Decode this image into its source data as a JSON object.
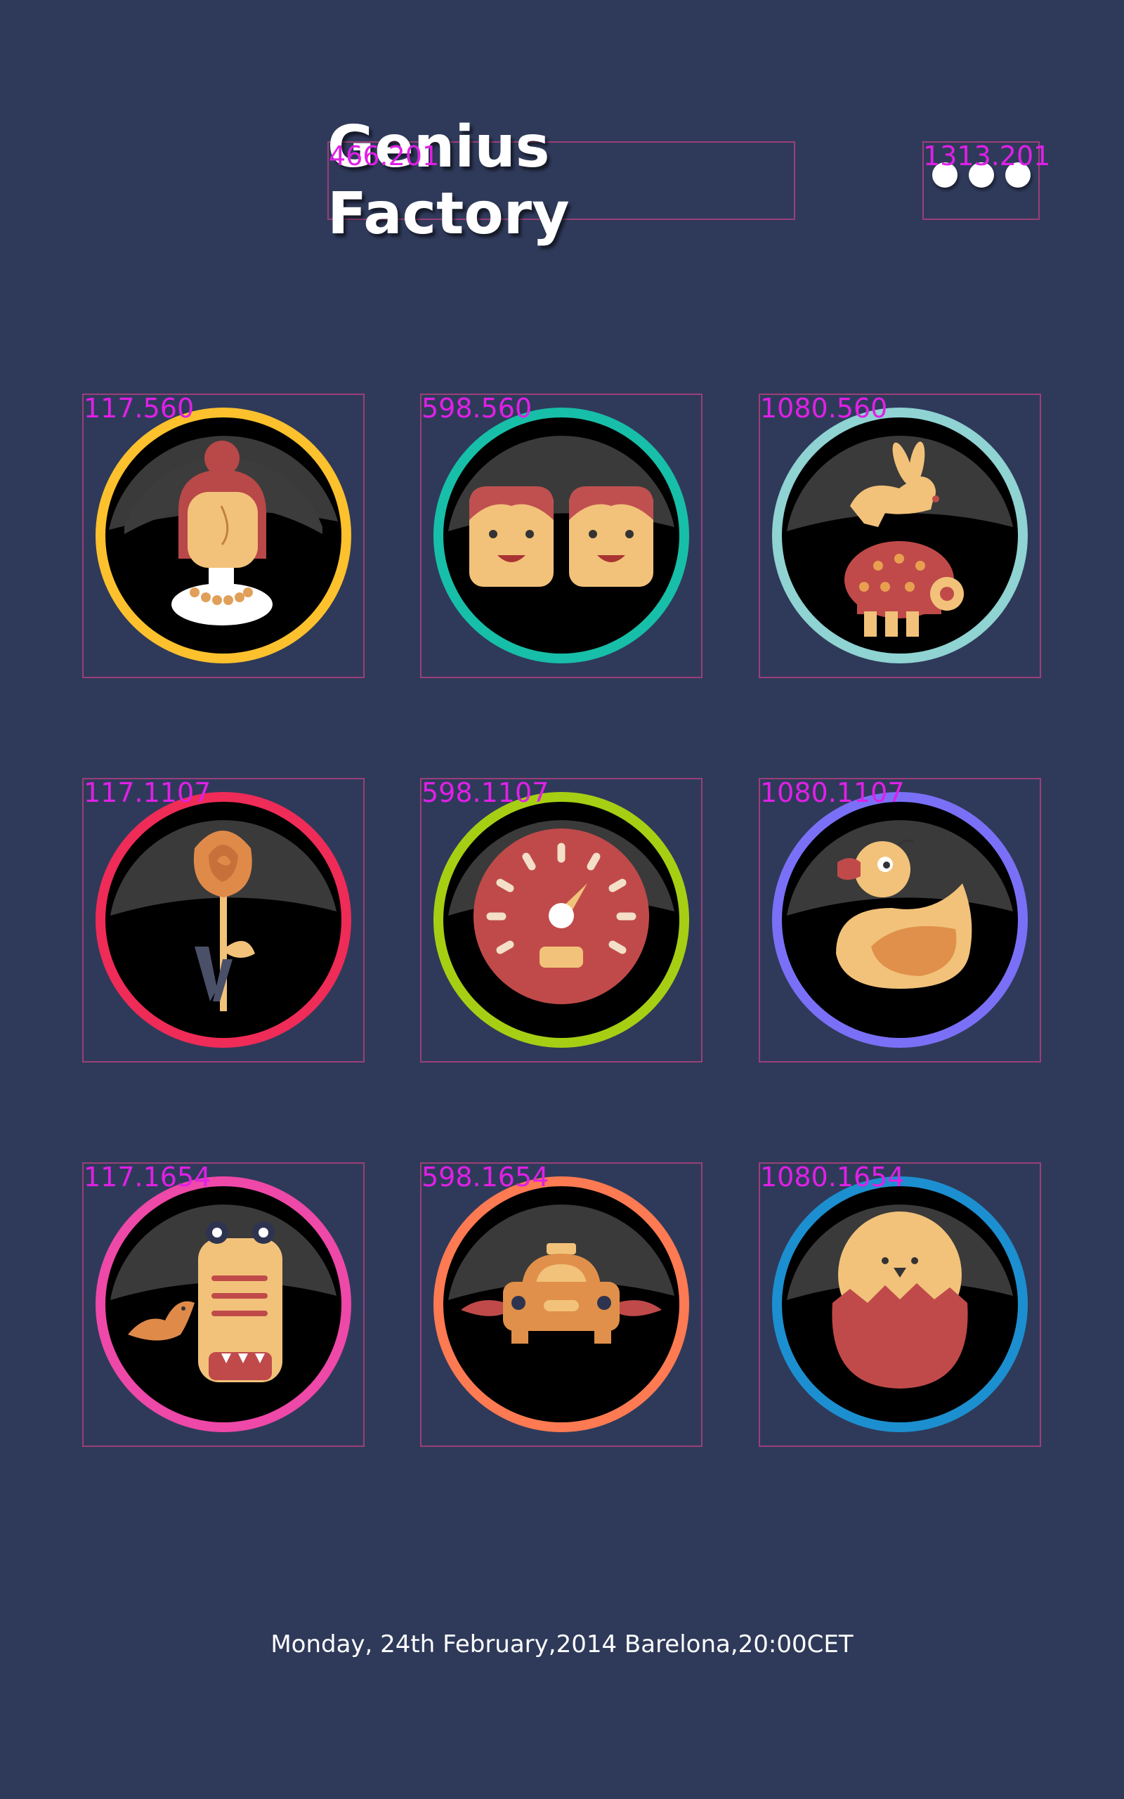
{
  "header": {
    "title": "Genius Factory",
    "title_coord": "466.201",
    "menu_coord": "1313.201",
    "menu_icon": "more-dots-icon"
  },
  "grid": [
    {
      "coord": "117.560",
      "icon": "woman-icon",
      "ring": "#fcc12d"
    },
    {
      "coord": "598.560",
      "icon": "twins-icon",
      "ring": "#17bfa8"
    },
    {
      "coord": "1080.560",
      "icon": "rabbit-tortoise-icon",
      "ring": "#8fd3d3"
    },
    {
      "coord": "117.1107",
      "icon": "rose-icon",
      "ring": "#ef2b57"
    },
    {
      "coord": "598.1107",
      "icon": "speedometer-icon",
      "ring": "#a6cf14"
    },
    {
      "coord": "1080.1107",
      "icon": "duck-icon",
      "ring": "#7a70f7"
    },
    {
      "coord": "117.1654",
      "icon": "crocodile-bird-icon",
      "ring": "#ee48a8"
    },
    {
      "coord": "598.1654",
      "icon": "winged-taxi-icon",
      "ring": "#fd7a52"
    },
    {
      "coord": "1080.1654",
      "icon": "hatching-chick-icon",
      "ring": "#1c8fd0"
    }
  ],
  "colors": {
    "background": "#2f3a5a",
    "guide": "#9a3f78",
    "coord_text": "#e020e6",
    "skin": "#f2c27a",
    "red": "#c04a4a"
  },
  "footer": {
    "text": "Monday, 24th February,2014 Barelona,20:00CET"
  }
}
